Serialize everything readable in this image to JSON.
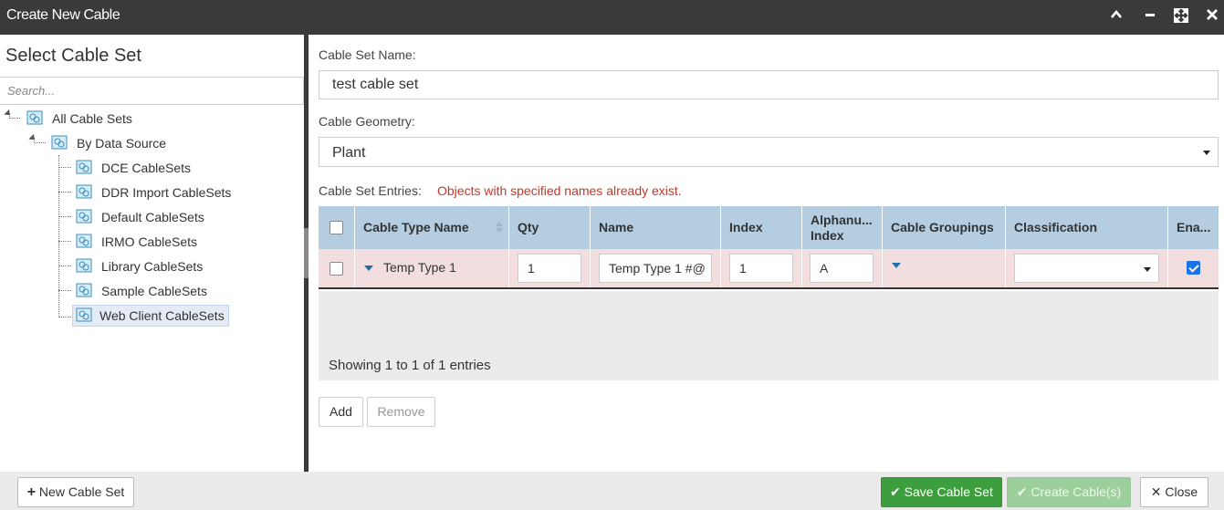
{
  "window": {
    "title": "Create New Cable",
    "controls": {
      "collapse": "⌃",
      "minimize": "▬",
      "maximize": "⤢",
      "close": "✕"
    }
  },
  "left_panel": {
    "heading": "Select Cable Set",
    "search_placeholder": "Search...",
    "tree": {
      "root": "All Cable Sets",
      "group": "By Data Source",
      "items": [
        "DCE CableSets",
        "DDR Import CableSets",
        "Default CableSets",
        "IRMO CableSets",
        "Library CableSets",
        "Sample CableSets",
        "Web Client CableSets"
      ],
      "selected": "Web Client CableSets"
    }
  },
  "form": {
    "cable_set_name_label": "Cable Set Name:",
    "cable_set_name_value": "test cable set",
    "cable_geometry_label": "Cable Geometry:",
    "cable_geometry_value": "Plant",
    "entries_label": "Cable Set Entries:",
    "error_message": "Objects with specified names already exist."
  },
  "grid": {
    "columns": [
      "Cable Type Name",
      "Qty",
      "Name",
      "Index",
      "Alphanu...\nIndex",
      "Cable Groupings",
      "Classification",
      "Ena..."
    ],
    "rows": [
      {
        "cable_type_name": "Temp Type 1",
        "qty": "1",
        "name": "Temp Type 1 #@",
        "index": "1",
        "alphanumeric_index": "A",
        "classification": "",
        "enabled": true,
        "selected": false
      }
    ],
    "info": "Showing 1 to 1 of 1 entries"
  },
  "grid_buttons": {
    "add": "Add",
    "remove": "Remove"
  },
  "footer": {
    "new_cable_set": "New Cable Set",
    "save_cable_set": "Save Cable Set",
    "create_cables": "Create Cable(s)",
    "close": "Close"
  },
  "colors": {
    "titlebar": "#3a3a3a",
    "grid_header": "#b4cde0",
    "error_row": "#f2dede",
    "error_text": "#c0392b",
    "save_green": "#3c9e3c",
    "checkbox_blue": "#1a73e8"
  }
}
